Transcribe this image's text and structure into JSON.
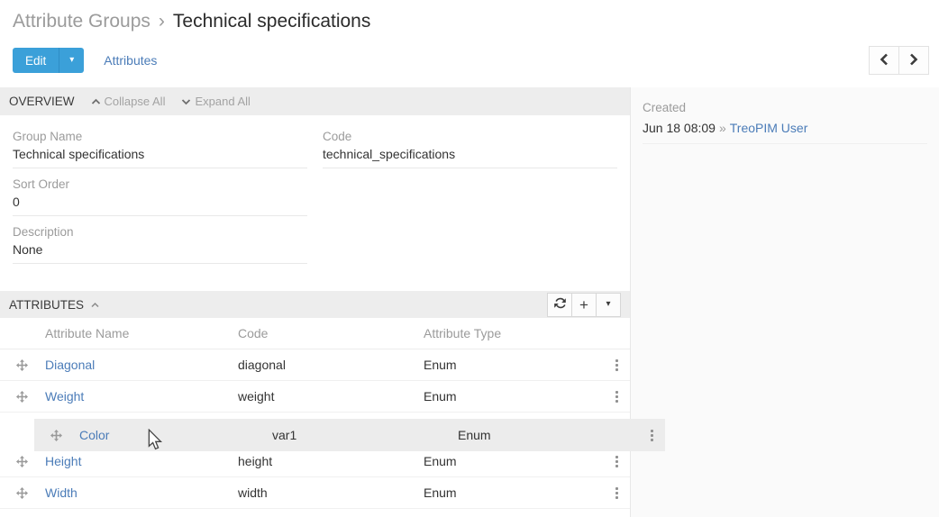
{
  "breadcrumb": {
    "parent": "Attribute Groups",
    "separator": "›",
    "current": "Technical specifications"
  },
  "toolbar": {
    "edit_label": "Edit",
    "attributes_tab": "Attributes"
  },
  "icons": {
    "edit_dropdown": "▾",
    "panel_more_dropdown": "▾",
    "add": "+",
    "refresh": "refresh-arrows",
    "prev": "chevron-left",
    "next": "chevron-right",
    "collapse_all": "chevron-up",
    "expand_all": "chevron-down",
    "drag_handle": "move-cross",
    "row_menu": "vertical-ellipsis",
    "cursor": "arrow-pointer"
  },
  "overview": {
    "title": "OVERVIEW",
    "collapse_all": "Collapse All",
    "expand_all": "Expand All",
    "fields": {
      "group_name": {
        "label": "Group Name",
        "value": "Technical specifications"
      },
      "code": {
        "label": "Code",
        "value": "technical_specifications"
      },
      "sort_order": {
        "label": "Sort Order",
        "value": "0"
      },
      "description": {
        "label": "Description",
        "value": "None"
      }
    }
  },
  "created_panel": {
    "label": "Created",
    "date": "Jun 18 08:09",
    "separator": "»",
    "user": "TreoPIM User"
  },
  "attributes": {
    "title": "ATTRIBUTES",
    "columns": {
      "name": "Attribute Name",
      "code": "Code",
      "type": "Attribute Type"
    },
    "rows": [
      {
        "name": "Diagonal",
        "code": "diagonal",
        "type": "Enum"
      },
      {
        "name": "Weight",
        "code": "weight",
        "type": "Enum"
      },
      {
        "name": "Height",
        "code": "height",
        "type": "Enum"
      },
      {
        "name": "Width",
        "code": "width",
        "type": "Enum"
      }
    ],
    "dragged_row": {
      "name": "Color",
      "code": "var1",
      "type": "Enum"
    }
  },
  "colors": {
    "primary_button": "#3ba0d9",
    "link": "#4b7cb8",
    "panel_header_bg": "#ededed",
    "dragged_row_bg": "#ececec",
    "label_gray": "#9b9b9b",
    "sidebar_bg": "#fafafa"
  }
}
